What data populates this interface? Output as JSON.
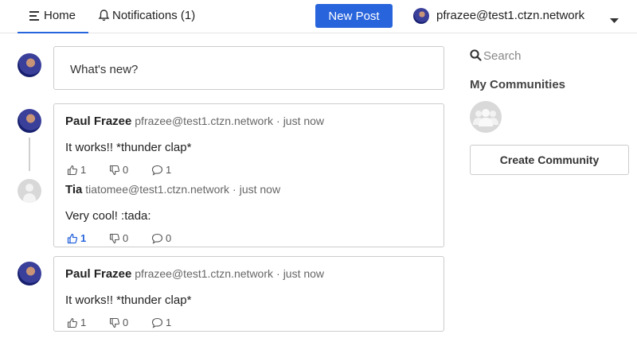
{
  "header": {
    "home_label": "Home",
    "notifications_label": "Notifications (1)",
    "new_post_label": "New Post",
    "user_handle": "pfrazee@test1.ctzn.network"
  },
  "composer": {
    "placeholder": "What's new?"
  },
  "posts": [
    {
      "author": "Paul Frazee",
      "handle": "pfrazee@test1.ctzn.network",
      "sep": "·",
      "time": "just now",
      "text": "It works!! *thunder clap*",
      "likes": "1",
      "dislikes": "0",
      "replies": "1",
      "reply": {
        "author": "Tia",
        "handle": "tiatomee@test1.ctzn.network",
        "sep": "·",
        "time": "just now",
        "text": "Very cool! :tada:",
        "likes": "1",
        "dislikes": "0",
        "replies": "0",
        "liked_by_me": true
      }
    },
    {
      "author": "Paul Frazee",
      "handle": "pfrazee@test1.ctzn.network",
      "sep": "·",
      "time": "just now",
      "text": "It works!! *thunder clap*",
      "likes": "1",
      "dislikes": "0",
      "replies": "1"
    }
  ],
  "sidebar": {
    "search_placeholder": "Search",
    "my_communities_title": "My Communities",
    "create_community_label": "Create Community"
  },
  "colors": {
    "accent": "#2864dc",
    "border": "#cccccc",
    "muted": "#666666"
  },
  "icons": [
    "menu-icon",
    "bell-icon",
    "caret-down-icon",
    "search-icon",
    "thumbs-up-icon",
    "thumbs-down-icon",
    "comment-icon",
    "group-icon"
  ]
}
